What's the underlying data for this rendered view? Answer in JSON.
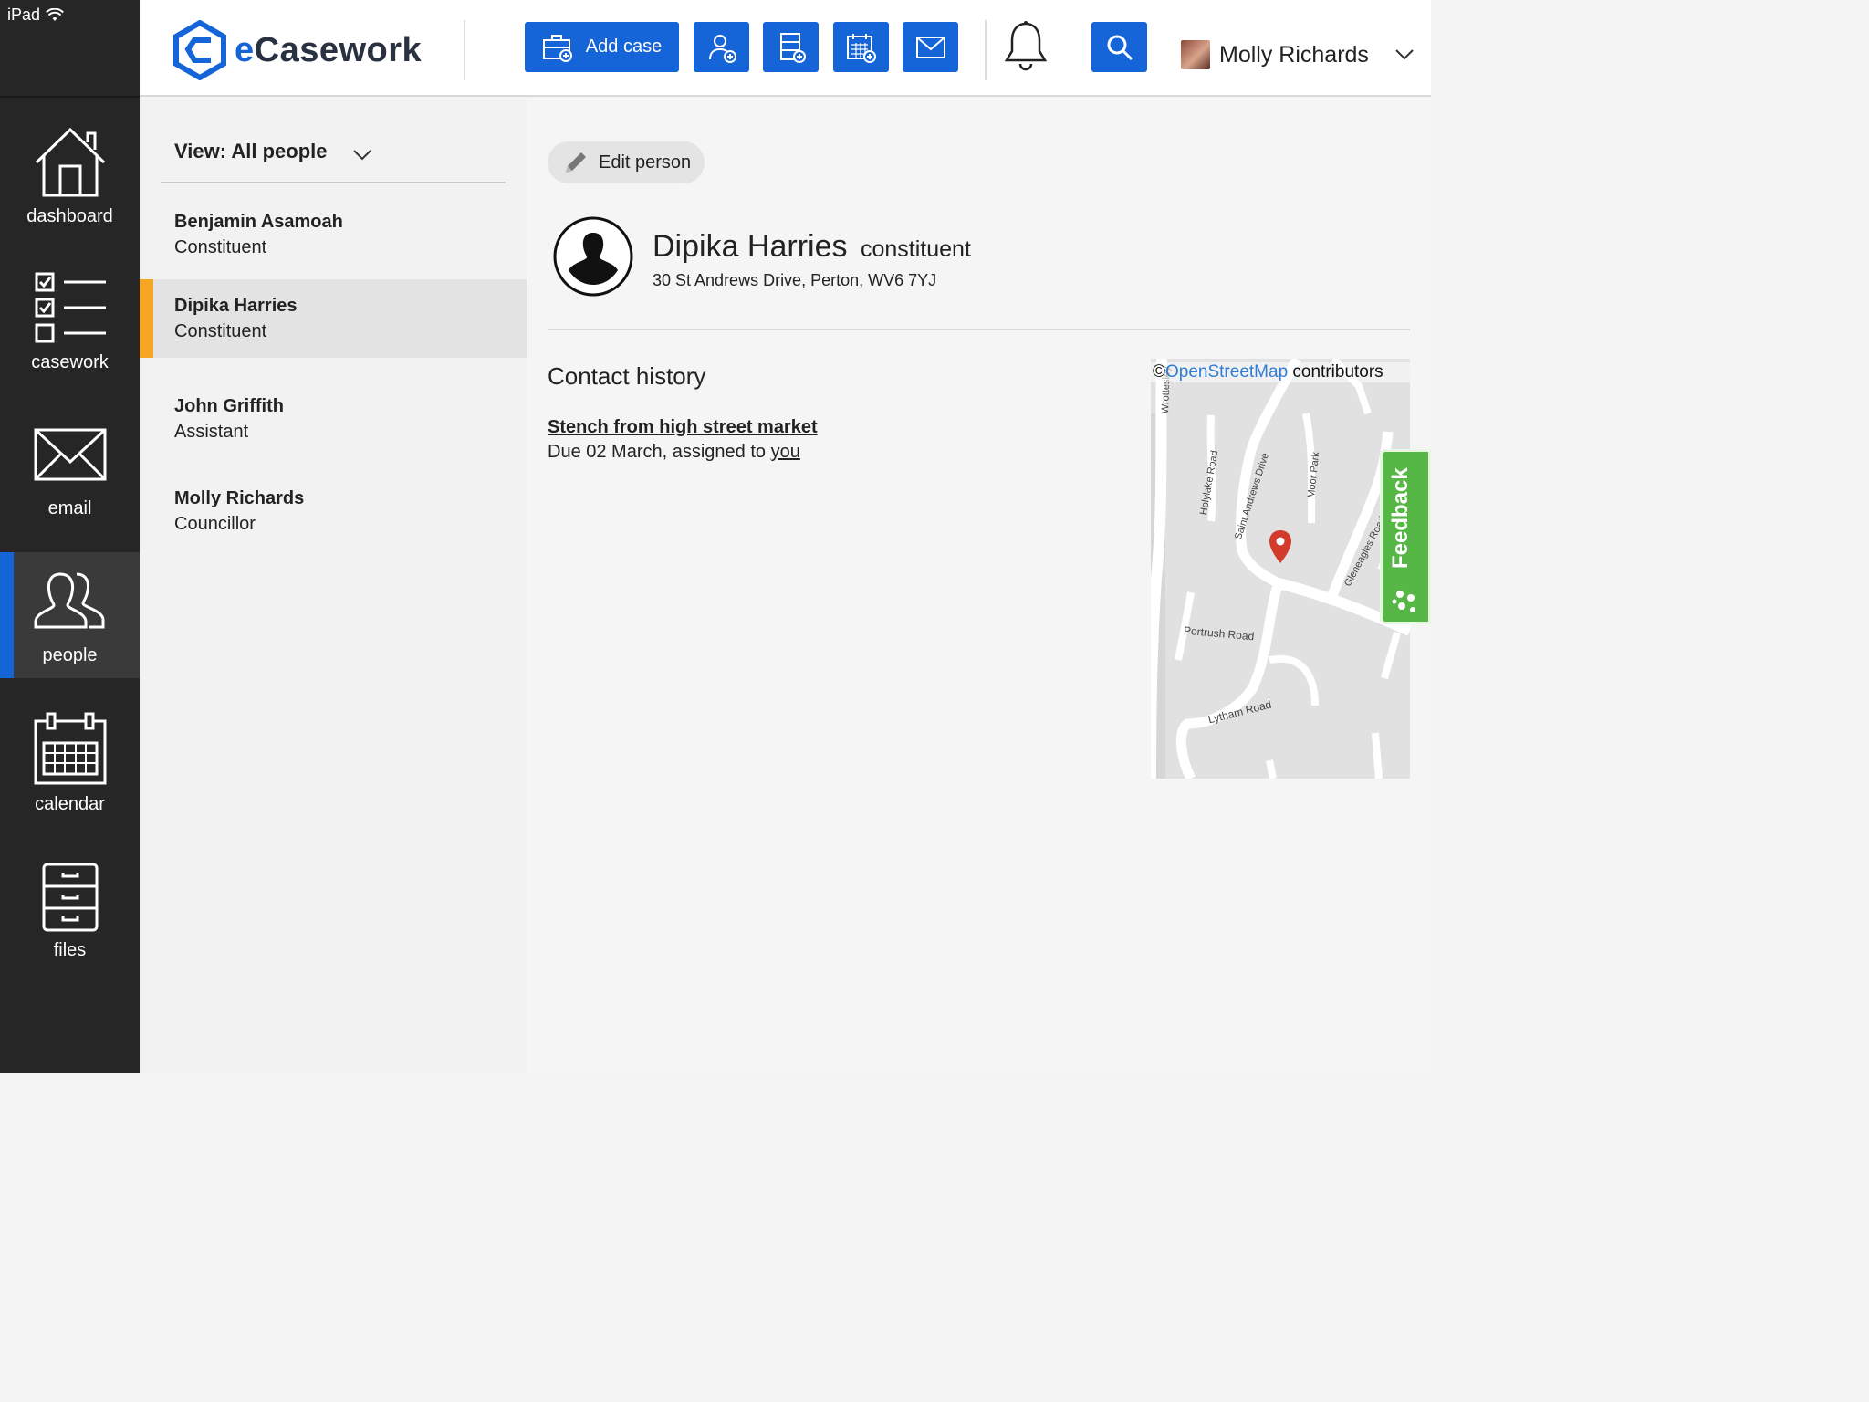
{
  "status_bar": {
    "device": "iPad"
  },
  "app": {
    "logo_text_e": "e",
    "logo_text_rest": "Casework"
  },
  "header": {
    "add_case_label": "Add case",
    "user_name": "Molly Richards"
  },
  "nav": {
    "items": [
      {
        "label": "dashboard",
        "icon": "home-icon"
      },
      {
        "label": "casework",
        "icon": "checklist-icon"
      },
      {
        "label": "email",
        "icon": "envelope-icon"
      },
      {
        "label": "people",
        "icon": "people-icon",
        "active": true
      },
      {
        "label": "calendar",
        "icon": "calendar-icon"
      },
      {
        "label": "files",
        "icon": "file-cabinet-icon"
      }
    ]
  },
  "people_list": {
    "view_label": "View: All people",
    "items": [
      {
        "name": "Benjamin Asamoah",
        "role": "Constituent"
      },
      {
        "name": "Dipika Harries",
        "role": "Constituent",
        "selected": true
      },
      {
        "name": "John Griffith",
        "role": "Assistant"
      },
      {
        "name": "Molly Richards",
        "role": "Councillor"
      }
    ]
  },
  "detail": {
    "edit_label": "Edit person",
    "name": "Dipika Harries",
    "type": "constituent",
    "address": "30 St Andrews Drive, Perton, WV6 7YJ",
    "contact_history_title": "Contact history",
    "case": {
      "title": "Stench from high street market",
      "meta_prefix": "Due 02 March, assigned to ",
      "assignee": "you"
    }
  },
  "map": {
    "attribution_symbol": "©",
    "attribution_link": "OpenStreetMap",
    "attribution_suffix": " contributors",
    "road_labels": [
      "Wrottesley",
      "Holylake Road",
      "Saint Andrews Drive",
      "Moor Park",
      "Gleneagles Road",
      "Portrush Road",
      "Lytham Road"
    ]
  },
  "feedback": {
    "label": "Feedback"
  },
  "colors": {
    "accent": "#1565d8",
    "selected_marker": "#f5a623",
    "feedback": "#56b646",
    "sidebar": "#262626"
  }
}
